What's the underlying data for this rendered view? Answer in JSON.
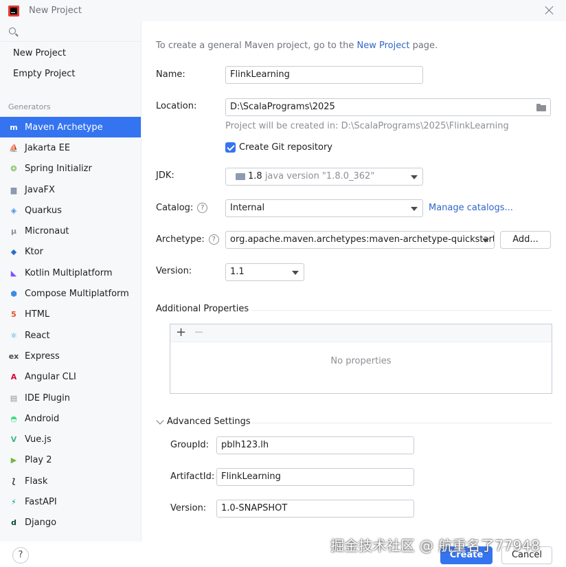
{
  "window": {
    "title": "New Project"
  },
  "sidebar": {
    "search_placeholder": "",
    "top_items": [
      {
        "label": "New Project"
      },
      {
        "label": "Empty Project"
      }
    ],
    "section_label": "Generators",
    "generators": [
      {
        "label": "Maven Archetype",
        "icon": "maven-icon",
        "glyph": "m",
        "color": "#ffffff",
        "selected": true
      },
      {
        "label": "Jakarta EE",
        "icon": "jakarta-icon",
        "glyph": "⛵",
        "color": "#f2a23a"
      },
      {
        "label": "Spring Initializr",
        "icon": "spring-icon",
        "glyph": "❂",
        "color": "#6db33f"
      },
      {
        "label": "JavaFX",
        "icon": "javafx-icon",
        "glyph": "▆",
        "color": "#8c9bb0"
      },
      {
        "label": "Quarkus",
        "icon": "quarkus-icon",
        "glyph": "◈",
        "color": "#4695eb"
      },
      {
        "label": "Micronaut",
        "icon": "micronaut-icon",
        "glyph": "μ",
        "color": "#8c8f94"
      },
      {
        "label": "Ktor",
        "icon": "ktor-icon",
        "glyph": "◆",
        "color": "#2f6ecb"
      },
      {
        "label": "Kotlin Multiplatform",
        "icon": "kotlin-icon",
        "glyph": "◣",
        "color": "#7f52ff"
      },
      {
        "label": "Compose Multiplatform",
        "icon": "compose-icon",
        "glyph": "⬢",
        "color": "#3c8be8"
      },
      {
        "label": "HTML",
        "icon": "html-icon",
        "glyph": "5",
        "color": "#e44d26"
      },
      {
        "label": "React",
        "icon": "react-icon",
        "glyph": "⚛",
        "color": "#2f9fd8"
      },
      {
        "label": "Express",
        "icon": "express-icon",
        "glyph": "ex",
        "color": "#4a4a4a"
      },
      {
        "label": "Angular CLI",
        "icon": "angular-icon",
        "glyph": "A",
        "color": "#dd0031"
      },
      {
        "label": "IDE Plugin",
        "icon": "ide-plugin-icon",
        "glyph": "▤",
        "color": "#8c8f94"
      },
      {
        "label": "Android",
        "icon": "android-icon",
        "glyph": "◓",
        "color": "#3ddc84"
      },
      {
        "label": "Vue.js",
        "icon": "vue-icon",
        "glyph": "V",
        "color": "#41b883"
      },
      {
        "label": "Play 2",
        "icon": "play-icon",
        "glyph": "▶",
        "color": "#6fb843"
      },
      {
        "label": "Flask",
        "icon": "flask-icon",
        "glyph": "⟅",
        "color": "#2a2a2a"
      },
      {
        "label": "FastAPI",
        "icon": "fastapi-icon",
        "glyph": "⚡",
        "color": "#059688"
      },
      {
        "label": "Django",
        "icon": "django-icon",
        "glyph": "d",
        "color": "#0c4b33"
      }
    ]
  },
  "main": {
    "intro_prefix": "To create a general Maven project, go to the ",
    "intro_link": "New Project",
    "intro_suffix": " page.",
    "name_label": "Name:",
    "name_value": "FlinkLearning",
    "location_label": "Location:",
    "location_value": "D:\\ScalaPrograms\\2025",
    "location_hint": "Project will be created in: D:\\ScalaPrograms\\2025\\FlinkLearning",
    "git_label": "Create Git repository",
    "git_checked": true,
    "jdk_label": "JDK:",
    "jdk_version": "1.8",
    "jdk_detail": " java version \"1.8.0_362\"",
    "catalog_label": "Catalog:",
    "catalog_value": "Internal",
    "manage_catalogs": "Manage catalogs...",
    "archetype_label": "Archetype:",
    "archetype_value": "org.apache.maven.archetypes:maven-archetype-quickstart",
    "add_button": "Add...",
    "version_label": "Version:",
    "version_value": "1.1",
    "additional_properties_title": "Additional Properties",
    "no_properties": "No properties",
    "advanced_title": "Advanced Settings",
    "groupid_label": "GroupId:",
    "groupid_value": "pblh123.lh",
    "artifactid_label": "ArtifactId:",
    "artifactid_value": "FlinkLearning",
    "adv_version_label": "Version:",
    "adv_version_value": "1.0-SNAPSHOT"
  },
  "footer": {
    "help": "?",
    "create": "Create",
    "cancel": "Cancel",
    "watermark": "掘金技术社区 @ 航重名了77948"
  }
}
